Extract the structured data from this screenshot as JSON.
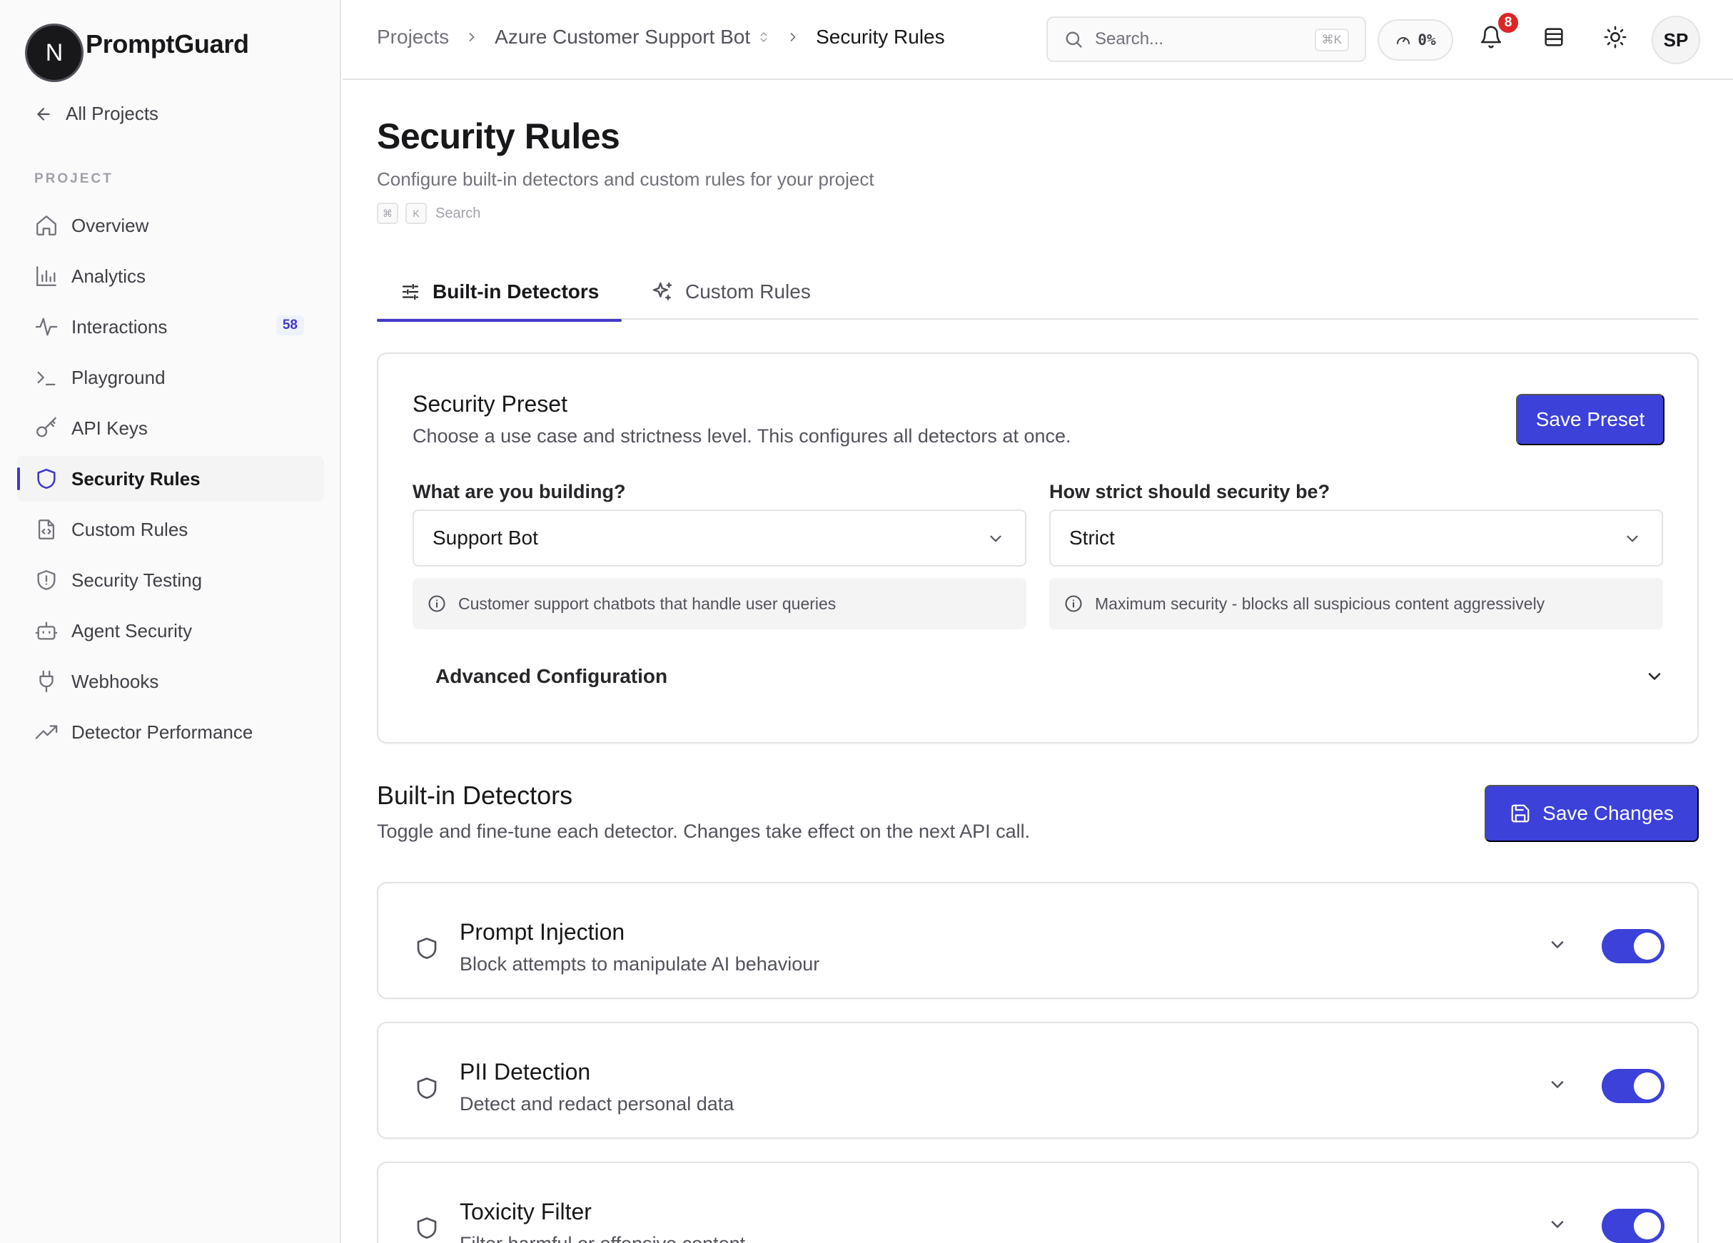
{
  "brand": {
    "logo_letter": "N",
    "name": "PromptGuard"
  },
  "sidebar": {
    "back_label": "All Projects",
    "section_label": "PROJECT",
    "items": [
      {
        "label": "Overview",
        "icon": "home-icon"
      },
      {
        "label": "Analytics",
        "icon": "bar-chart-icon"
      },
      {
        "label": "Interactions",
        "icon": "activity-icon",
        "badge": "58"
      },
      {
        "label": "Playground",
        "icon": "terminal-icon"
      },
      {
        "label": "API Keys",
        "icon": "key-icon"
      },
      {
        "label": "Security Rules",
        "icon": "shield-icon",
        "active": true
      },
      {
        "label": "Custom Rules",
        "icon": "file-code-icon"
      },
      {
        "label": "Security Testing",
        "icon": "shield-alert-icon"
      },
      {
        "label": "Agent Security",
        "icon": "bot-icon"
      },
      {
        "label": "Webhooks",
        "icon": "plug-icon"
      },
      {
        "label": "Detector Performance",
        "icon": "trending-up-icon"
      }
    ]
  },
  "topbar": {
    "breadcrumb": {
      "root": "Projects",
      "project": "Azure Customer Support Bot",
      "current": "Security Rules"
    },
    "search": {
      "placeholder": "Search...",
      "shortcut": "⌘K"
    },
    "usage": "0%",
    "notifications_count": "8",
    "avatar_initials": "SP"
  },
  "page": {
    "title": "Security Rules",
    "subtitle": "Configure built-in detectors and custom rules for your project",
    "kbd_hint": {
      "key1": "⌘",
      "key2": "K",
      "label": "Search"
    },
    "tabs": [
      {
        "label": "Built-in Detectors",
        "active": true
      },
      {
        "label": "Custom Rules",
        "active": false
      }
    ]
  },
  "preset": {
    "title": "Security Preset",
    "description": "Choose a use case and strictness level. This configures all detectors at once.",
    "save_label": "Save Preset",
    "use_case": {
      "label": "What are you building?",
      "value": "Support Bot",
      "info": "Customer support chatbots that handle user queries"
    },
    "strictness": {
      "label": "How strict should security be?",
      "value": "Strict",
      "info": "Maximum security - blocks all suspicious content aggressively"
    },
    "advanced_label": "Advanced Configuration"
  },
  "detectors": {
    "title": "Built-in Detectors",
    "description": "Toggle and fine-tune each detector. Changes take effect on the next API call.",
    "save_label": "Save Changes",
    "items": [
      {
        "name": "Prompt Injection",
        "description": "Block attempts to manipulate AI behaviour",
        "enabled": true
      },
      {
        "name": "PII Detection",
        "description": "Detect and redact personal data",
        "enabled": true
      },
      {
        "name": "Toxicity Filter",
        "description": "Filter harmful or offensive content",
        "enabled": true
      }
    ]
  },
  "colors": {
    "accent": "#3b41d9",
    "active_indicator": "#4338ca",
    "notification": "#dc2626"
  }
}
